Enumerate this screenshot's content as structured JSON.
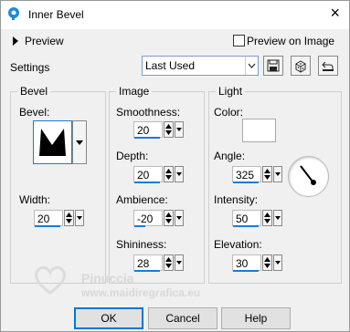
{
  "window": {
    "title": "Inner Bevel",
    "close_glyph": "×"
  },
  "preview": {
    "label": "Preview",
    "checkbox_label": "Preview on Image",
    "checked": false
  },
  "settings": {
    "label": "Settings",
    "preset_value": "Last Used"
  },
  "bevel": {
    "group_title": "Bevel",
    "bevel_label": "Bevel:",
    "width_label": "Width:",
    "width_value": "20"
  },
  "image": {
    "group_title": "Image",
    "smoothness_label": "Smoothness:",
    "smoothness_value": "20",
    "depth_label": "Depth:",
    "depth_value": "20",
    "ambience_label": "Ambience:",
    "ambience_value": "-20",
    "shininess_label": "Shininess:",
    "shininess_value": "28"
  },
  "light": {
    "group_title": "Light",
    "color_label": "Color:",
    "color_value": "#ffffff",
    "angle_label": "Angle:",
    "angle_value": "325",
    "intensity_label": "Intensity:",
    "intensity_value": "50",
    "elevation_label": "Elevation:",
    "elevation_value": "30"
  },
  "buttons": {
    "ok": "OK",
    "cancel": "Cancel",
    "help": "Help"
  },
  "watermark": {
    "name": "Pinuccia",
    "url": "www.maidiregrafica.eu"
  },
  "colors": {
    "accent": "#1a7bd6",
    "focus_border": "#0078d7"
  }
}
